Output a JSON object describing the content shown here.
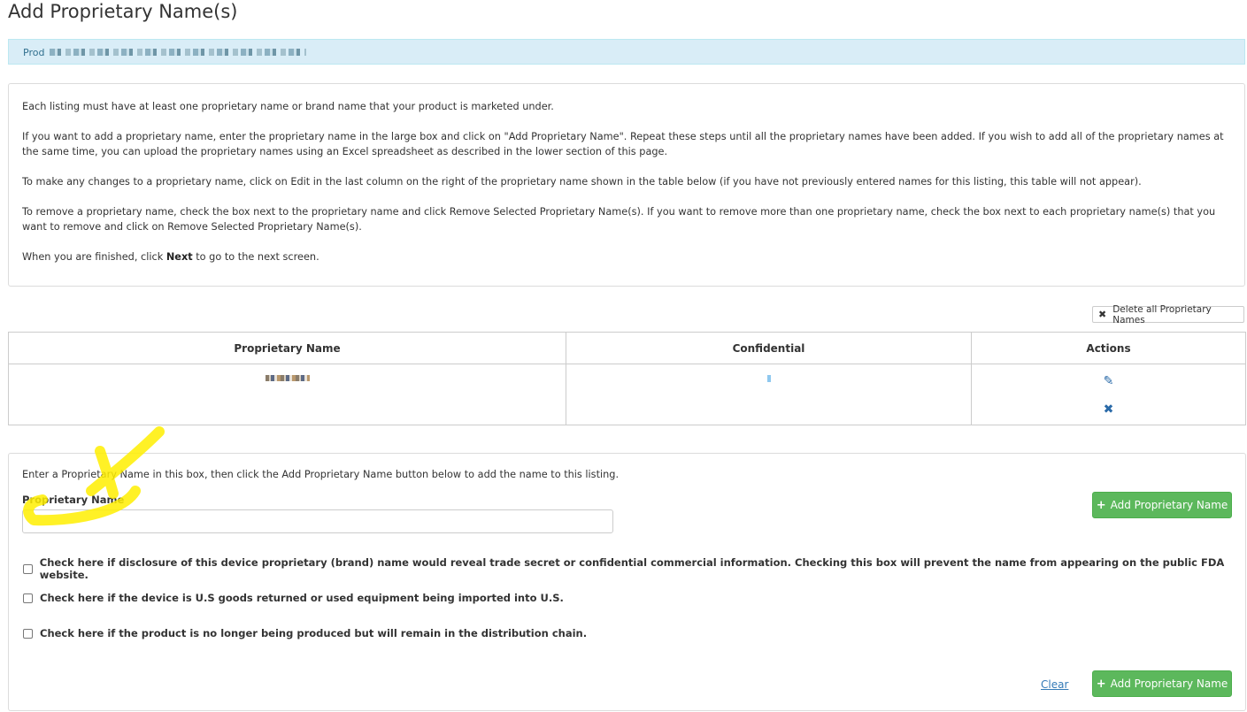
{
  "page": {
    "title": "Add Proprietary Name(s)"
  },
  "info_bar": {
    "label": "Prod"
  },
  "instructions": {
    "p1": "Each listing must have at least one proprietary name or brand name that your product is marketed under.",
    "p2": "If you want to add a proprietary name, enter the proprietary name in the large box and click on \"Add Proprietary Name\". Repeat these steps until all the proprietary names have been added. If you wish to add all of the proprietary names at the same time, you can upload the proprietary names using an Excel spreadsheet as described in the lower section of this page.",
    "p3": "To make any changes to a proprietary name, click on Edit in the last column on the right of the proprietary name shown in the table below (if you have not previously entered names for this listing, this table will not appear).",
    "p4": "To remove a proprietary name, check the box next to the proprietary name and click Remove Selected Proprietary Name(s). If you want to remove more than one proprietary name, check the box next to each proprietary name(s) that you want to remove and click on Remove Selected Proprietary Name(s).",
    "p5_before": "When you are finished, click ",
    "p5_bold": "Next",
    "p5_after": " to go to the next screen."
  },
  "delete_all": {
    "label": "Delete all Proprietary Names",
    "icon": "close-icon"
  },
  "table": {
    "headers": [
      "Proprietary Name",
      "Confidential",
      "Actions"
    ],
    "actions": {
      "edit_icon": "pencil-icon",
      "delete_icon": "close-icon"
    }
  },
  "form": {
    "hint": "Enter a Proprietary Name in this box, then click the Add Proprietary Name button below to add the name to this listing.",
    "field_label": "Proprietary Name",
    "field_value": "",
    "add_button_label": "Add Proprietary Name",
    "checkboxes": [
      {
        "label": "Check here if disclosure of this device proprietary (brand) name would reveal trade secret or confidential commercial information. Checking this box will prevent the name from appearing on the public FDA website.",
        "checked": false
      },
      {
        "label": "Check here if the device is U.S goods returned or used equipment being imported into U.S.",
        "checked": false
      },
      {
        "label": "Check here if the product is no longer being produced but will remain in the distribution chain.",
        "checked": false
      }
    ],
    "clear_label": "Clear"
  },
  "colors": {
    "accent_green": "#5cb85c",
    "info_blue": "#d9edf7",
    "link_blue": "#337ab7",
    "annotation_yellow": "#ffee00"
  }
}
